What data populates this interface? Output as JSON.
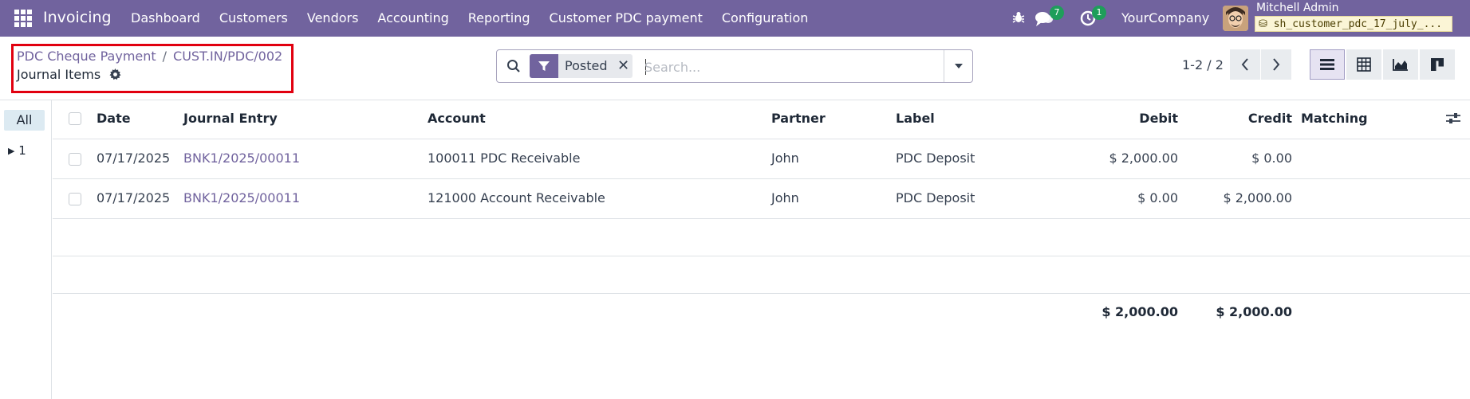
{
  "app": {
    "name": "Invoicing",
    "menu": [
      "Dashboard",
      "Customers",
      "Vendors",
      "Accounting",
      "Reporting",
      "Customer PDC payment",
      "Configuration"
    ],
    "messages_count": "7",
    "activities_count": "1",
    "company": "YourCompany",
    "user_name": "Mitchell Admin",
    "database": "sh_customer_pdc_17_july_..."
  },
  "breadcrumb": {
    "item1": "PDC Cheque Payment",
    "separator": "/",
    "item2": "CUST.IN/PDC/002",
    "current": "Journal Items"
  },
  "search": {
    "facet_value": "Posted",
    "facet_remove": "✕",
    "placeholder": "Search..."
  },
  "pager": {
    "value": "1-2 / 2"
  },
  "side_panel": {
    "all_label": "All",
    "group_label": "1"
  },
  "table": {
    "columns": [
      "Date",
      "Journal Entry",
      "Account",
      "Partner",
      "Label",
      "Debit",
      "Credit",
      "Matching"
    ],
    "rows": [
      {
        "date": "07/17/2025",
        "entry": "BNK1/2025/00011",
        "account": "100011 PDC Receivable",
        "partner": "John",
        "label": "PDC Deposit",
        "debit": "$ 2,000.00",
        "credit": "$ 0.00",
        "matching": ""
      },
      {
        "date": "07/17/2025",
        "entry": "BNK1/2025/00011",
        "account": "121000 Account Receivable",
        "partner": "John",
        "label": "PDC Deposit",
        "debit": "$ 0.00",
        "credit": "$ 2,000.00",
        "matching": ""
      }
    ],
    "totals": {
      "debit": "$ 2,000.00",
      "credit": "$ 2,000.00"
    }
  },
  "colors": {
    "brand": "#71639e",
    "highlight_border": "#e1000f",
    "badge": "#1e9e5a"
  }
}
